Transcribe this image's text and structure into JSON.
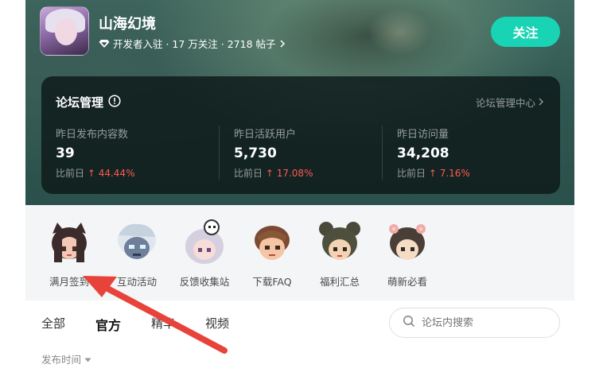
{
  "forum": {
    "name": "山海幻境",
    "meta": "开发者入驻 · 17 万关注 · 2718 帖子",
    "follow_label": "关注"
  },
  "admin_panel": {
    "title": "论坛管理",
    "link": "论坛管理中心",
    "stats": [
      {
        "label": "昨日发布内容数",
        "value": "39",
        "compare_prefix": "比前日",
        "compare_value": "↑ 44.44%"
      },
      {
        "label": "昨日活跃用户",
        "value": "5,730",
        "compare_prefix": "比前日",
        "compare_value": "↑ 17.08%"
      },
      {
        "label": "昨日访问量",
        "value": "34,208",
        "compare_prefix": "比前日",
        "compare_value": "↑ 7.16%"
      }
    ]
  },
  "shortcuts": [
    {
      "label": "满月签到",
      "icon": "cat-ears-girl-icon"
    },
    {
      "label": "互动活动",
      "icon": "ghost-character-icon"
    },
    {
      "label": "反馈收集站",
      "icon": "skull-hat-girl-icon"
    },
    {
      "label": "下载FAQ",
      "icon": "brown-hair-boy-icon"
    },
    {
      "label": "福利汇总",
      "icon": "twin-buns-girl-icon"
    },
    {
      "label": "萌新必看",
      "icon": "flower-girl-icon"
    }
  ],
  "tabs": [
    {
      "label": "全部",
      "active": false
    },
    {
      "label": "官方",
      "active": true
    },
    {
      "label": "精华",
      "active": false
    },
    {
      "label": "视频",
      "active": false
    }
  ],
  "search": {
    "placeholder": "论坛内搜索"
  },
  "sort": {
    "label": "发布时间"
  },
  "colors": {
    "accent": "#19d4b4",
    "up": "#ff5a52",
    "annotation_arrow": "#e8433a"
  }
}
